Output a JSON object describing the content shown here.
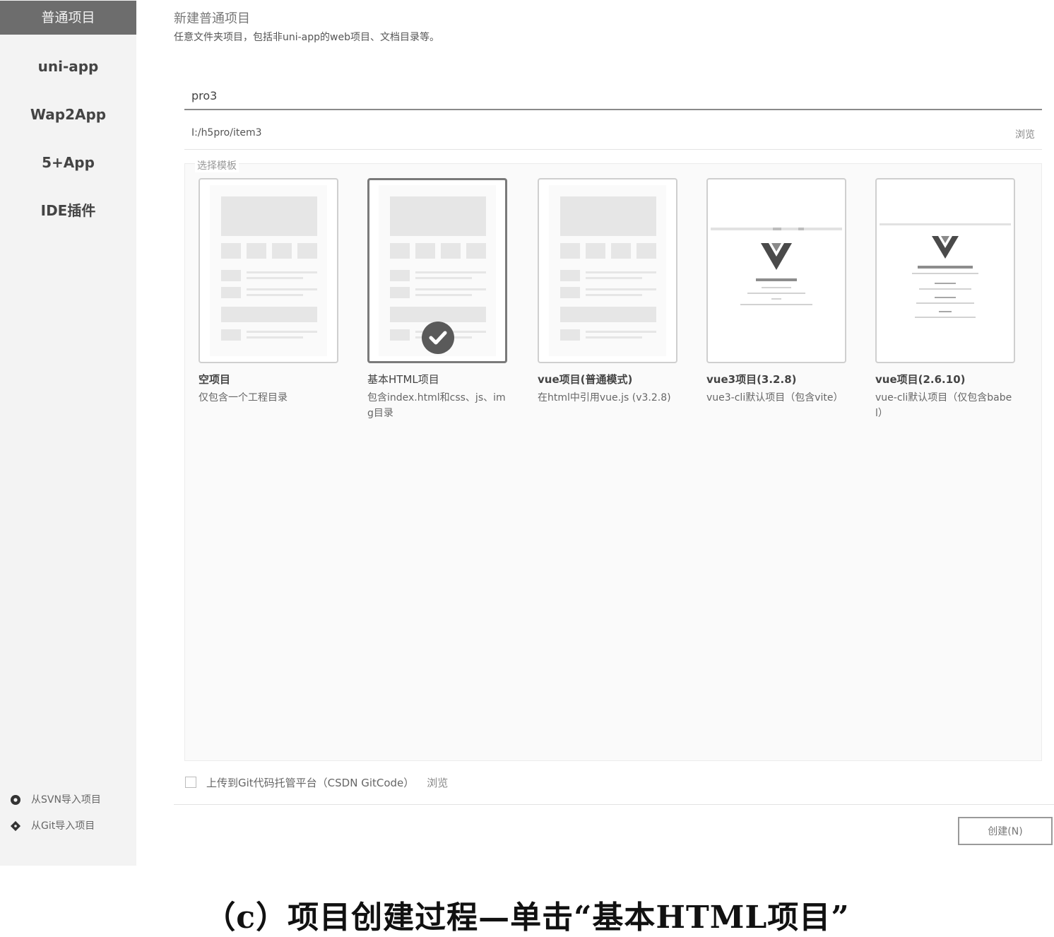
{
  "sidebar": {
    "items": [
      {
        "label": "普通项目",
        "active": true
      },
      {
        "label": "uni-app"
      },
      {
        "label": "Wap2App"
      },
      {
        "label": "5+App"
      },
      {
        "label": "IDE插件"
      }
    ],
    "import_svn": "从SVN导入项目",
    "import_git": "从Git导入项目"
  },
  "main": {
    "title": "新建普通项目",
    "description": "任意文件夹项目，包括非uni-app的web项目、文档目录等。",
    "project_name": "pro3",
    "path": "I:/h5pro/item3",
    "browse_label": "浏览",
    "template_label": "选择模板",
    "templates": [
      {
        "name": "空项目",
        "desc": "仅包含一个工程目录",
        "bold": true
      },
      {
        "name": "基本HTML项目",
        "desc": "包含index.html和css、js、img目录",
        "selected": true
      },
      {
        "name": "vue项目(普通模式)",
        "desc": "在html中引用vue.js (v3.2.8)",
        "bold": true
      },
      {
        "name": "vue3项目(3.2.8)",
        "desc": "vue3-cli默认项目（包含vite）",
        "bold": true
      },
      {
        "name": "vue项目(2.6.10)",
        "desc": "vue-cli默认项目（仅包含babel）",
        "bold": true
      }
    ],
    "upload_label": "上传到Git代码托管平台（CSDN GitCode）",
    "upload_browse": "浏览",
    "create_button": "创建(N)"
  },
  "caption": "（c）项目创建过程—单击“基本HTML项目”"
}
